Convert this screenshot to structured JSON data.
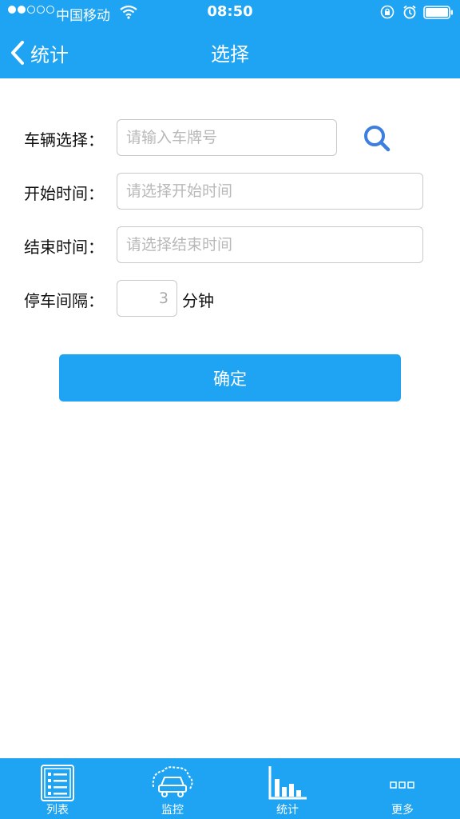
{
  "status_bar": {
    "carrier": "中国移动",
    "time": "08:50"
  },
  "header": {
    "back_label": "统计",
    "title": "选择"
  },
  "form": {
    "vehicle": {
      "label": "车辆选择：",
      "placeholder": "请输入车牌号",
      "value": ""
    },
    "start_time": {
      "label": "开始时间：",
      "placeholder": "请选择开始时间",
      "value": ""
    },
    "end_time": {
      "label": "结束时间：",
      "placeholder": "请选择结束时间",
      "value": ""
    },
    "interval": {
      "label": "停车间隔：",
      "value": "3",
      "unit": "分钟"
    }
  },
  "confirm_label": "确定",
  "tabs": [
    {
      "label": "列表",
      "icon": "list-icon"
    },
    {
      "label": "监控",
      "icon": "monitor-car-icon"
    },
    {
      "label": "统计",
      "icon": "bar-chart-icon",
      "selected": true
    },
    {
      "label": "更多",
      "icon": "more-icon"
    }
  ],
  "colors": {
    "accent": "#1ea4f2",
    "search_icon": "#3d7ee0",
    "input_border": "#c9c9c9"
  }
}
